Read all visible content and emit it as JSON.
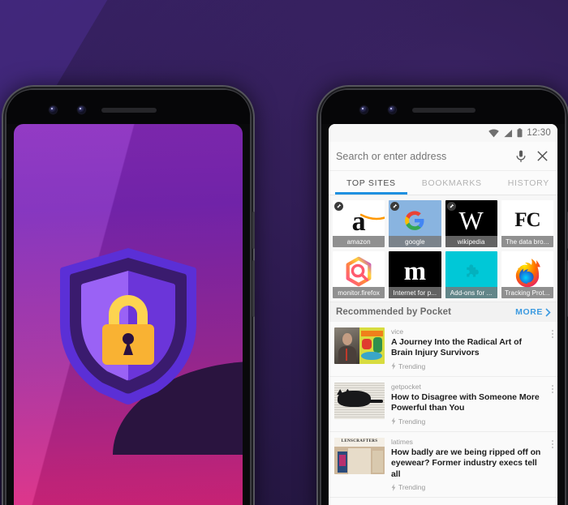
{
  "scene": {
    "background_color": "#2c1a4e",
    "accent_color": "#1e90e0"
  },
  "left_phone": {
    "name": "privacy-splash-phone",
    "screen_gradient_from": "#8a2bbf",
    "screen_gradient_to": "#e0267f",
    "artwork": {
      "name": "shield-lock-illustration",
      "shield_outer_color": "#5b2fd6",
      "shield_dark_color": "#3a1b6e",
      "shield_light_color": "#9a62f5",
      "shield_mid_color": "#6b35d9",
      "lock_body_color": "#f9b233",
      "lock_shackle_color": "#fdd450",
      "keyhole_color": "#2a1140"
    }
  },
  "right_phone": {
    "name": "firefox-browser-phone",
    "statusbar": {
      "time": "12:30",
      "icons": [
        "wifi-icon",
        "signal-icon",
        "battery-icon"
      ]
    },
    "urlbar": {
      "placeholder": "Search or enter address",
      "value": "",
      "mic_icon": "microphone-icon",
      "close_icon": "close-icon"
    },
    "tabs": [
      {
        "label": "TOP SITES",
        "active": true
      },
      {
        "label": "BOOKMARKS",
        "active": false
      },
      {
        "label": "HISTORY",
        "active": false
      }
    ],
    "top_sites": [
      {
        "label": "amazon",
        "pinned": true,
        "bg": "#ffffff",
        "glyph": "amazon-logo"
      },
      {
        "label": "google",
        "pinned": true,
        "bg": "#89b4e0",
        "glyph": "google-logo"
      },
      {
        "label": "wikipedia",
        "pinned": true,
        "bg": "#000000",
        "glyph": "wikipedia-logo"
      },
      {
        "label": "The data bro...",
        "pinned": false,
        "bg": "#ffffff",
        "glyph": "fc-logo"
      },
      {
        "label": "monitor.firefox",
        "pinned": false,
        "bg": "#ffffff",
        "glyph": "firefox-monitor-logo"
      },
      {
        "label": "Internet for p...",
        "pinned": false,
        "bg": "#000000",
        "glyph": "mozilla-m-logo"
      },
      {
        "label": "Add-ons for ...",
        "pinned": false,
        "bg": "#00c8d7",
        "glyph": "addons-puzzle-logo"
      },
      {
        "label": "Tracking Prot...",
        "pinned": false,
        "bg": "#ffffff",
        "glyph": "firefox-logo"
      }
    ],
    "pocket": {
      "title": "Recommended by Pocket",
      "more_label": "MORE",
      "more_chevron": "chevron-right-icon",
      "items": [
        {
          "source": "vice",
          "headline": "A Journey Into the Radical Art of Brain Injury Survivors",
          "badge": "Trending",
          "badge_icon": "trending-bolt-icon",
          "thumb": "portrait-and-colorful-painting"
        },
        {
          "source": "getpocket",
          "headline": "How to Disagree with Someone More Powerful than You",
          "badge": "Trending",
          "badge_icon": "trending-bolt-icon",
          "thumb": "black-cat-on-newspaper"
        },
        {
          "source": "latimes",
          "headline": "How badly are we being ripped off on eyewear? Former industry execs tell all",
          "badge": "Trending",
          "badge_icon": "trending-bolt-icon",
          "thumb": "lenscrafters-storefront"
        }
      ]
    }
  }
}
